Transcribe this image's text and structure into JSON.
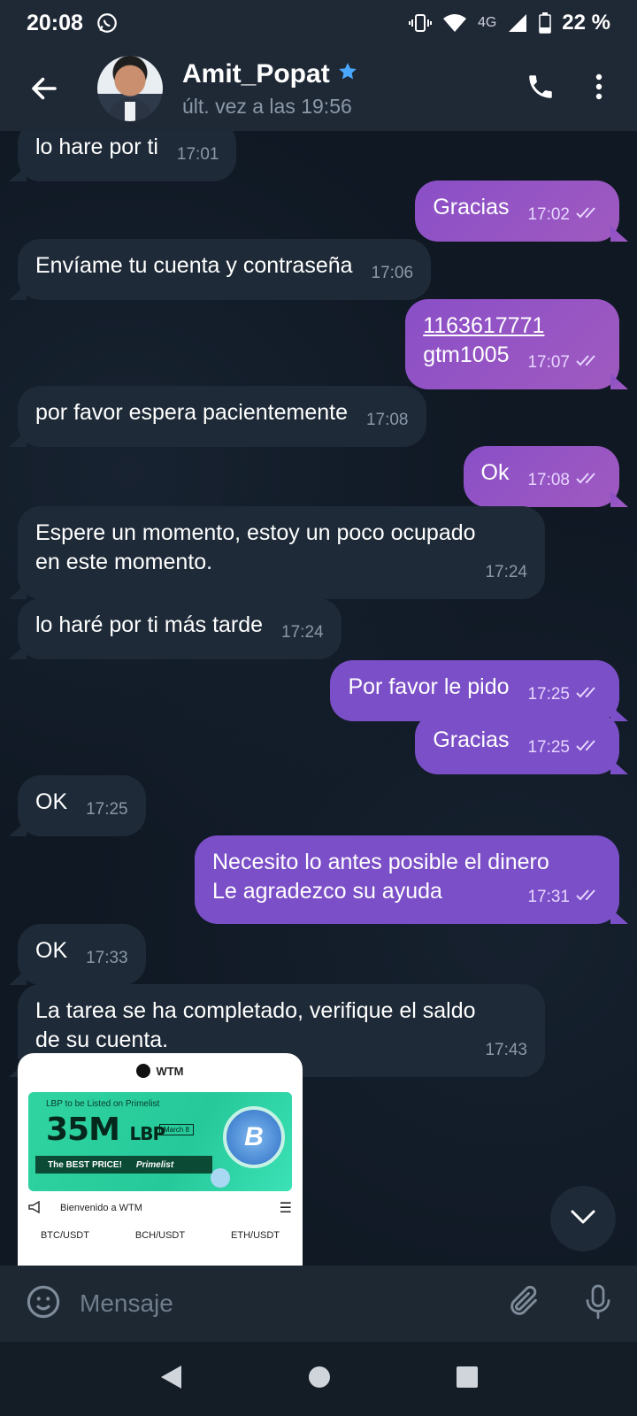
{
  "status_bar": {
    "time": "20:08",
    "network": "4G",
    "battery": "22 %",
    "icons": [
      "whatsapp-icon",
      "vibrate-icon",
      "wifi-icon",
      "signal-icon",
      "battery-icon"
    ]
  },
  "header": {
    "contact_name": "Amit_Popat",
    "last_seen": "últ. vez a las 19:56",
    "verified_icon": "star-badge-icon",
    "icons": [
      "back-arrow-icon",
      "phone-icon",
      "more-vert-icon"
    ]
  },
  "messages": [
    {
      "dir": "in",
      "text": "lo hare por ti",
      "time": "17:01"
    },
    {
      "dir": "out",
      "text": "Gracias",
      "time": "17:02"
    },
    {
      "dir": "in",
      "text": "Envíame tu cuenta y contraseña",
      "time": "17:06"
    },
    {
      "dir": "out",
      "link": "1163617771",
      "text": "gtm1005",
      "time": "17:07"
    },
    {
      "dir": "in",
      "text": "por favor espera pacientemente",
      "time": "17:08"
    },
    {
      "dir": "out",
      "text": "Ok",
      "time": "17:08"
    },
    {
      "dir": "in",
      "line1": "Espere un momento, estoy un poco ocupado",
      "line2": "en este momento.",
      "time": "17:24"
    },
    {
      "dir": "in",
      "text": "lo haré por ti más tarde",
      "time": "17:24"
    },
    {
      "dir": "out",
      "text": "Por favor le pido",
      "time": "17:25"
    },
    {
      "dir": "out",
      "text": "Gracias",
      "time": "17:25"
    },
    {
      "dir": "in",
      "text": "OK",
      "time": "17:25"
    },
    {
      "dir": "out",
      "line1": "Necesito lo antes posible el dinero",
      "line2": "Le agradezco su ayuda",
      "time": "17:31"
    },
    {
      "dir": "in",
      "text": "OK",
      "time": "17:33"
    },
    {
      "dir": "in",
      "line1": "La tarea se ha completado, verifique el saldo",
      "line2": "de su cuenta.",
      "time": "17:43"
    }
  ],
  "image_preview": {
    "brand": "WTM",
    "banner_line1": "LBP to be Listed on Primelist",
    "banner_amount": "35M",
    "banner_token": "LBP",
    "banner_date": "March 8",
    "banner_strip1": "The BEST PRICE!",
    "banner_strip2": "Primelist",
    "coin_letter": "B",
    "notice": "Bienvenido a WTM",
    "pairs": [
      "BTC/USDT",
      "BCH/USDT",
      "ETH/USDT"
    ]
  },
  "input": {
    "placeholder": "Mensaje"
  },
  "colors": {
    "background": "#0f1823",
    "incoming_bubble": "#1e2a37",
    "outgoing_bubble": "#8a4fc7",
    "header": "#1f2936"
  }
}
